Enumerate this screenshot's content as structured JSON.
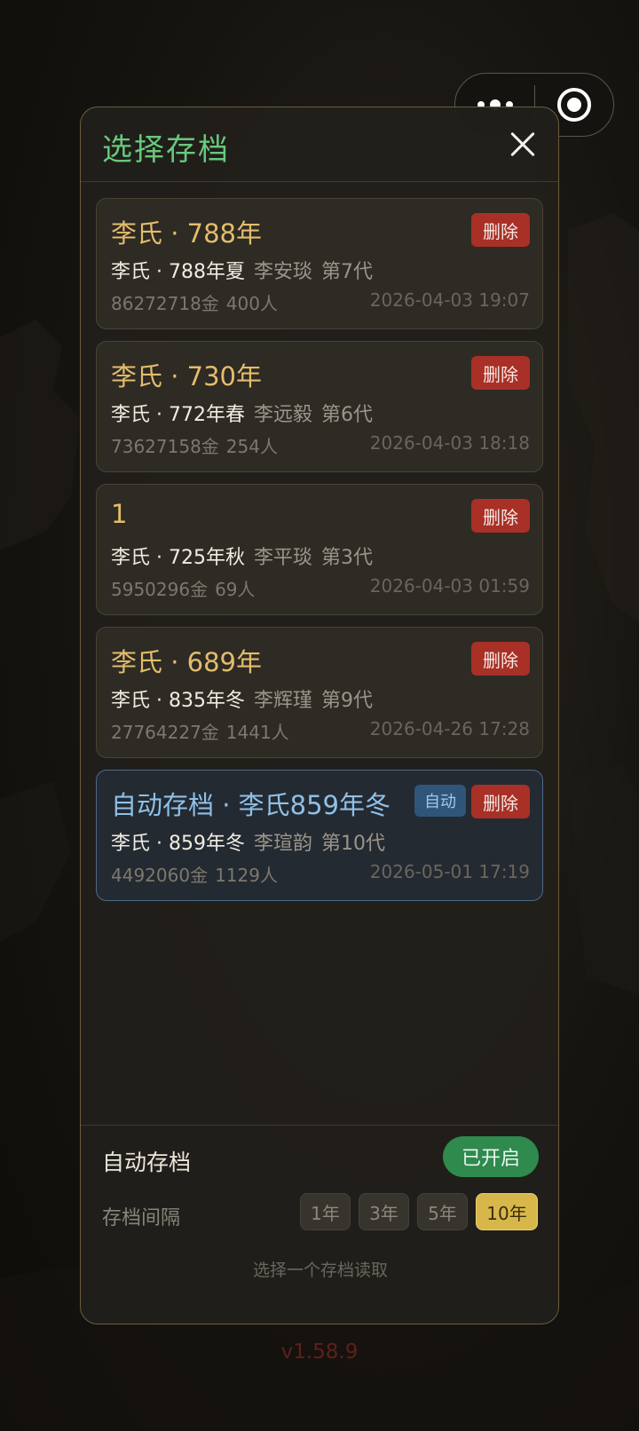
{
  "capsule": {
    "more_icon": "more-dots-icon",
    "target_icon": "target-icon"
  },
  "dialog": {
    "title": "选择存档",
    "close_icon": "close-icon"
  },
  "saves": [
    {
      "name": "李氏 · 788年",
      "clan_date": "李氏 · 788年夏",
      "person": "李安琰",
      "generation": "第7代",
      "gold": "86272718金",
      "people": "400人",
      "time": "2026-04-03 19:07",
      "delete_label": "删除"
    },
    {
      "name": "李氏 · 730年",
      "clan_date": "李氏 · 772年春",
      "person": "李远毅",
      "generation": "第6代",
      "gold": "73627158金",
      "people": "254人",
      "time": "2026-04-03 18:18",
      "delete_label": "删除"
    },
    {
      "name": "1",
      "clan_date": "李氏 · 725年秋",
      "person": "李平琰",
      "generation": "第3代",
      "gold": "5950296金",
      "people": "69人",
      "time": "2026-04-03 01:59",
      "delete_label": "删除"
    },
    {
      "name": "李氏 · 689年",
      "clan_date": "李氏 · 835年冬",
      "person": "李辉瑾",
      "generation": "第9代",
      "gold": "27764227金",
      "people": "1441人",
      "time": "2026-04-26 17:28",
      "delete_label": "删除"
    },
    {
      "name": "自动存档 · 李氏859年冬",
      "clan_date": "李氏 · 859年冬",
      "person": "李瑄韵",
      "generation": "第10代",
      "gold": "4492060金",
      "people": "1129人",
      "time": "2026-05-01 17:19",
      "delete_label": "删除",
      "auto_tag": "自动"
    }
  ],
  "footer": {
    "auto_save_label": "自动存档",
    "auto_save_state": "已开启",
    "interval_label": "存档间隔",
    "intervals": [
      "1年",
      "3年",
      "5年",
      "10年"
    ],
    "selected_interval": "10年",
    "hint": "选择一个存档读取"
  },
  "version": "v1.58.9",
  "colors": {
    "title_green": "#68c87c",
    "save_name_gold": "#e3bd6b",
    "auto_name_blue": "#8ec0e8",
    "delete_red": "#a83026",
    "toggle_green": "#2e8a4d",
    "interval_active": "#d8b74a"
  }
}
